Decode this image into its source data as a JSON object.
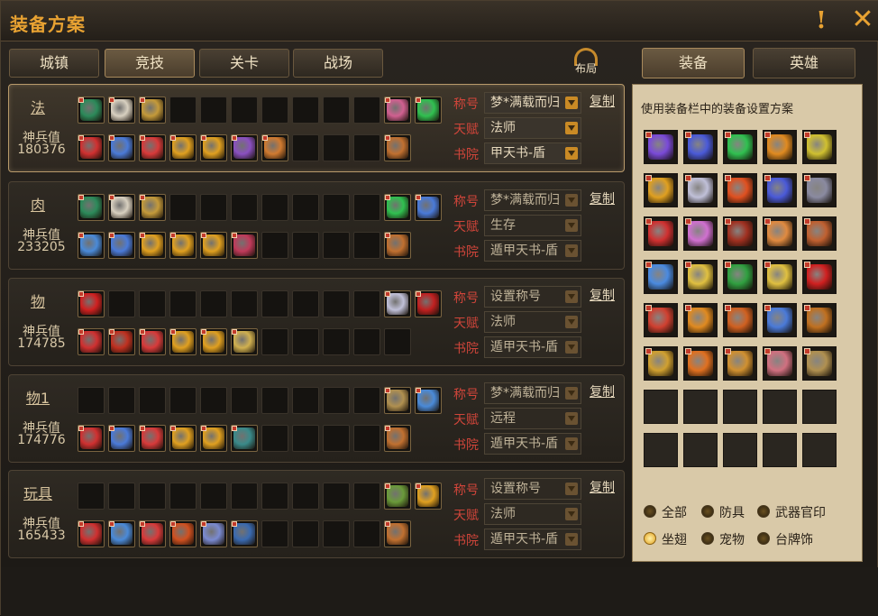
{
  "title": "装备方案",
  "icons": {
    "info": "!",
    "close": "✕"
  },
  "tabs": [
    "城镇",
    "竞技",
    "关卡",
    "战场"
  ],
  "active_tab": 1,
  "layout_label": "布局",
  "right_tabs": [
    "装备",
    "英雄"
  ],
  "active_right_tab": 0,
  "hint": "使用装备栏中的装备设置方案",
  "labels": {
    "title_field": "称号",
    "talent_field": "天赋",
    "academy_field": "书院",
    "power": "神兵值",
    "copy": "复制"
  },
  "schemes": [
    {
      "name": "法",
      "power": "180376",
      "title": "梦*满载而归",
      "talent": "法师",
      "academy": "甲天书-盾",
      "active": true,
      "row1": [
        "#2c8a5a",
        "#d8d0c0",
        "#c49a3a",
        null,
        null,
        null,
        null,
        null,
        null,
        null,
        "#d06090",
        "#30c050"
      ],
      "row2": [
        "#d03030",
        "#4a7ad8",
        "#d83a3a",
        "#e0a020",
        "#e0a020",
        "#8a50c0",
        "#d07a30",
        null,
        null,
        null,
        "#c07030"
      ]
    },
    {
      "name": "肉",
      "power": "233205",
      "title": "梦*满载而归",
      "talent": "生存",
      "academy": "遁甲天书-盾",
      "active": false,
      "row1": [
        "#2c8a5a",
        "#d8d0c0",
        "#c49a3a",
        null,
        null,
        null,
        null,
        null,
        null,
        null,
        "#30c050",
        "#4a7ad8"
      ],
      "row2": [
        "#4a8ad8",
        "#4a7ad8",
        "#e0a020",
        "#e0a020",
        "#e0a020",
        "#c03a5a",
        null,
        null,
        null,
        null,
        "#c07030"
      ]
    },
    {
      "name": "物",
      "power": "174785",
      "title": "设置称号",
      "talent": "法师",
      "academy": "遁甲天书-盾",
      "active": false,
      "row1": [
        "#d02020",
        null,
        null,
        null,
        null,
        null,
        null,
        null,
        null,
        null,
        "#c0c0d8",
        "#c02020"
      ],
      "row2": [
        "#d03030",
        "#c03020",
        "#d83a3a",
        "#e0a020",
        "#e0a020",
        "#d0b050",
        null,
        null,
        null,
        null,
        null
      ],
      "row2_extra": true
    },
    {
      "name": "物1",
      "power": "174776",
      "title": "梦*满载而归",
      "talent": "远程",
      "academy": "遁甲天书-盾",
      "active": false,
      "row1": [
        null,
        null,
        null,
        null,
        null,
        null,
        null,
        null,
        null,
        null,
        "#b09050",
        "#4a8ad8"
      ],
      "row2": [
        "#d03030",
        "#4a7ad8",
        "#d83a3a",
        "#e0a020",
        "#e0a020",
        "#3a8a8a",
        null,
        null,
        null,
        null,
        "#c07030"
      ]
    },
    {
      "name": "玩具",
      "power": "165433",
      "title": "设置称号",
      "talent": "法师",
      "academy": "遁甲天书-盾",
      "active": false,
      "row1": [
        null,
        null,
        null,
        null,
        null,
        null,
        null,
        null,
        null,
        null,
        "#6a9a3a",
        "#e0a020"
      ],
      "row2": [
        "#d03030",
        "#4a8ad8",
        "#d83a3a",
        "#d05020",
        "#7a8ad0",
        "#3a6ab0",
        null,
        null,
        null,
        null,
        "#c07030"
      ]
    }
  ],
  "inventory": [
    "#7a4ad8",
    "#4a5ad8",
    "#30c050",
    "#e08a20",
    "#d0c030",
    "#e0a020",
    "#c0c0d8",
    "#e05020",
    "#4a5ad8",
    "#8a8aa0",
    "#d03030",
    "#d070d0",
    "#a03020",
    "#e08a40",
    "#c06030",
    "#4a8ae0",
    "#e0c040",
    "#30a040",
    "#e0c040",
    "#d02020",
    "#d04030",
    "#e08a20",
    "#d06020",
    "#4a7ad8",
    "#c07020",
    "#d0a030",
    "#e07020",
    "#d09030",
    "#d07080",
    "#b09050",
    null,
    null,
    null,
    null,
    null,
    null,
    null,
    null,
    null,
    null
  ],
  "filters": [
    {
      "label": "全部",
      "on": false
    },
    {
      "label": "防具",
      "on": false
    },
    {
      "label": "武器官印",
      "on": false
    },
    {
      "label": "坐翅",
      "on": true
    },
    {
      "label": "宠物",
      "on": false
    },
    {
      "label": "台牌饰",
      "on": false
    }
  ]
}
